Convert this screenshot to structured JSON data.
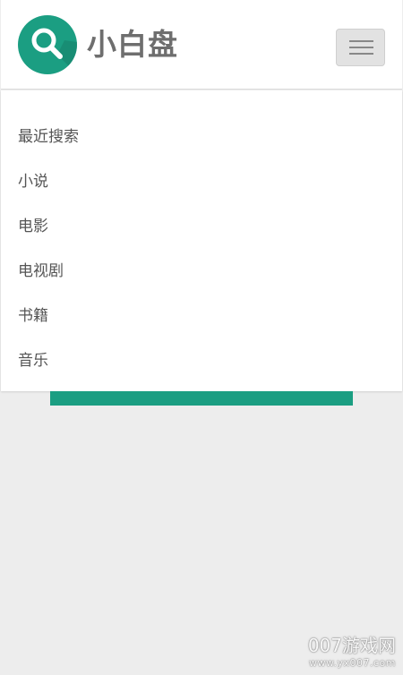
{
  "header": {
    "app_title": "小白盘",
    "logo_icon": "search-icon",
    "menu_button_icon": "hamburger-menu-icon"
  },
  "menu": {
    "items": [
      {
        "label": "最近搜索"
      },
      {
        "label": "小说"
      },
      {
        "label": "电影"
      },
      {
        "label": "电视剧"
      },
      {
        "label": "书籍"
      },
      {
        "label": "音乐"
      }
    ]
  },
  "watermark": {
    "main": "007游戏网",
    "url": "www.yx007.com"
  },
  "colors": {
    "brand_green": "#1b9e82",
    "page_background": "#ededed",
    "title_gray": "#6e6e6e"
  }
}
